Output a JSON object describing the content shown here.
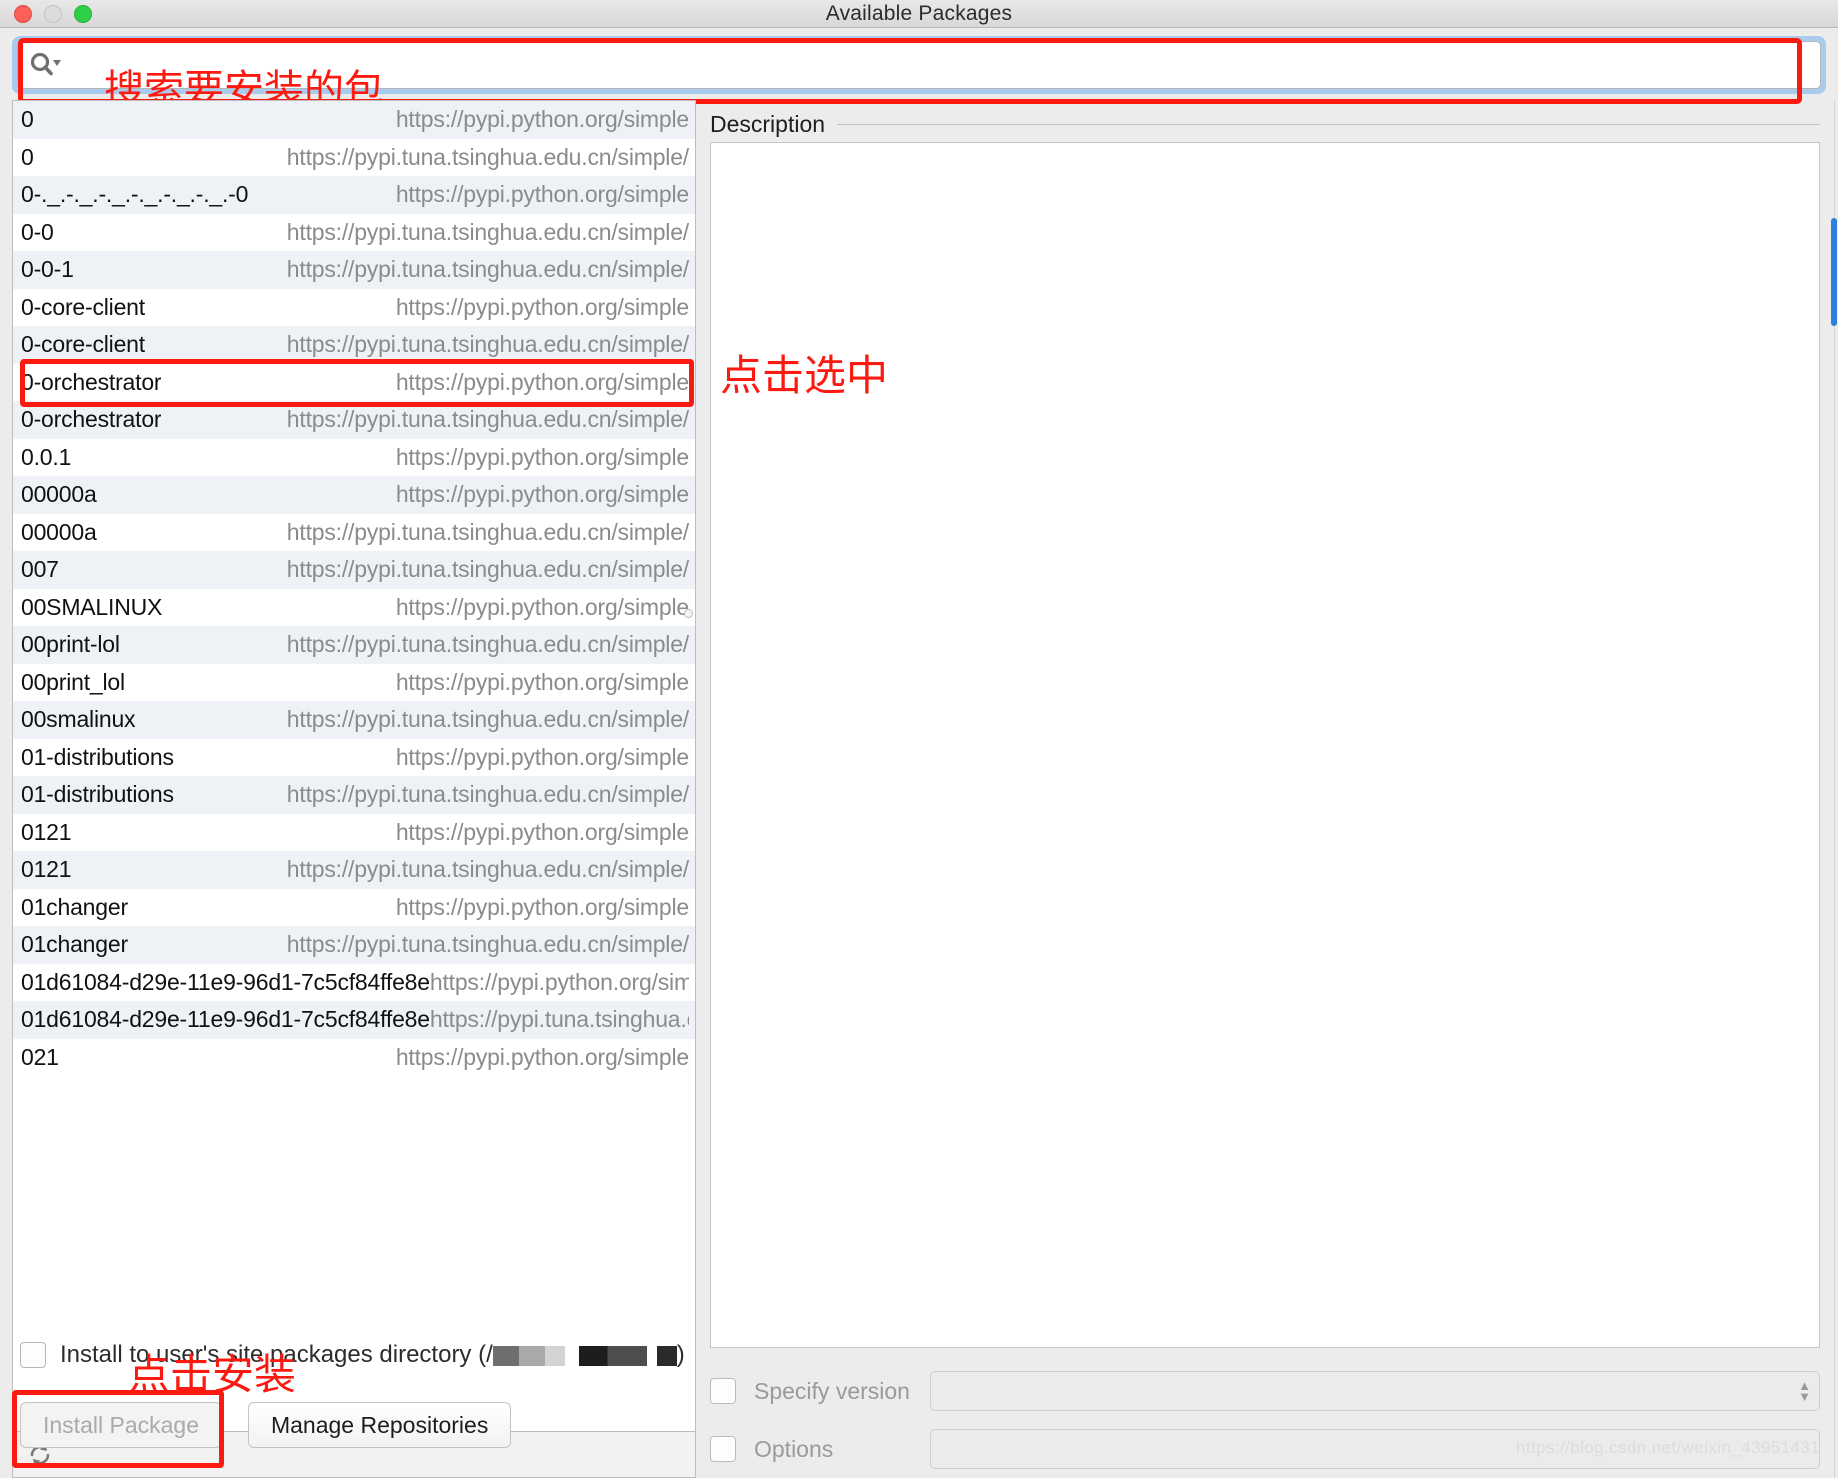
{
  "window": {
    "title": "Available Packages",
    "traffic_lights": [
      "close-button",
      "minimize-button",
      "zoom-button"
    ]
  },
  "search": {
    "icon": "search-icon",
    "value": "",
    "placeholder": "",
    "annotation": "搜索要安装的包"
  },
  "package_list": {
    "selected_index": 7,
    "selected_annotation": "点击选中",
    "rows": [
      {
        "name": "0",
        "url": "https://pypi.python.org/simple"
      },
      {
        "name": "0",
        "url": "https://pypi.tuna.tsinghua.edu.cn/simple/"
      },
      {
        "name": "0-._.-._.-._.-._.-._.-._.-0",
        "url": "https://pypi.python.org/simple"
      },
      {
        "name": "0-0",
        "url": "https://pypi.tuna.tsinghua.edu.cn/simple/"
      },
      {
        "name": "0-0-1",
        "url": "https://pypi.tuna.tsinghua.edu.cn/simple/"
      },
      {
        "name": "0-core-client",
        "url": "https://pypi.python.org/simple"
      },
      {
        "name": "0-core-client",
        "url": "https://pypi.tuna.tsinghua.edu.cn/simple/"
      },
      {
        "name": "0-orchestrator",
        "url": "https://pypi.python.org/simple"
      },
      {
        "name": "0-orchestrator",
        "url": "https://pypi.tuna.tsinghua.edu.cn/simple/"
      },
      {
        "name": "0.0.1",
        "url": "https://pypi.python.org/simple"
      },
      {
        "name": "00000a",
        "url": "https://pypi.python.org/simple"
      },
      {
        "name": "00000a",
        "url": "https://pypi.tuna.tsinghua.edu.cn/simple/"
      },
      {
        "name": "007",
        "url": "https://pypi.tuna.tsinghua.edu.cn/simple/"
      },
      {
        "name": "00SMALINUX",
        "url": "https://pypi.python.org/simple"
      },
      {
        "name": "00print-lol",
        "url": "https://pypi.tuna.tsinghua.edu.cn/simple/"
      },
      {
        "name": "00print_lol",
        "url": "https://pypi.python.org/simple"
      },
      {
        "name": "00smalinux",
        "url": "https://pypi.tuna.tsinghua.edu.cn/simple/"
      },
      {
        "name": "01-distributions",
        "url": "https://pypi.python.org/simple"
      },
      {
        "name": "01-distributions",
        "url": "https://pypi.tuna.tsinghua.edu.cn/simple/"
      },
      {
        "name": "0121",
        "url": "https://pypi.python.org/simple"
      },
      {
        "name": "0121",
        "url": "https://pypi.tuna.tsinghua.edu.cn/simple/"
      },
      {
        "name": "01changer",
        "url": "https://pypi.python.org/simple"
      },
      {
        "name": "01changer",
        "url": "https://pypi.tuna.tsinghua.edu.cn/simple/"
      },
      {
        "name": "01d61084-d29e-11e9-96d1-7c5cf84ffe8e",
        "url": "https://pypi.python.org/simple"
      },
      {
        "name": "01d61084-d29e-11e9-96d1-7c5cf84ffe8e",
        "url": "https://pypi.tuna.tsinghua.edu.cn/simple/"
      },
      {
        "name": "021",
        "url": "https://pypi.python.org/simple"
      }
    ]
  },
  "list_toolbar": {
    "refresh_icon": "refresh-icon"
  },
  "description": {
    "label": "Description",
    "content": ""
  },
  "options": {
    "specify_version": {
      "label": "Specify version",
      "checked": false,
      "value": ""
    },
    "options": {
      "label": "Options",
      "checked": false,
      "value": ""
    }
  },
  "footer": {
    "site_packages": {
      "label_prefix": "Install to user's site packages directory (/",
      "label_suffix": ")",
      "checked": false
    },
    "install_button": {
      "label": "Install Package",
      "enabled": false
    },
    "manage_button": {
      "label": "Manage Repositories",
      "enabled": true
    },
    "install_annotation": "点击安装"
  },
  "watermark": "https://blog.csdn.net/weixin_43951431",
  "colors": {
    "annotation_red": "#fc1a10",
    "focus_blue": "#a8cbee",
    "row_alt": "#eef2f7",
    "url_grey": "#8b8b8b"
  }
}
